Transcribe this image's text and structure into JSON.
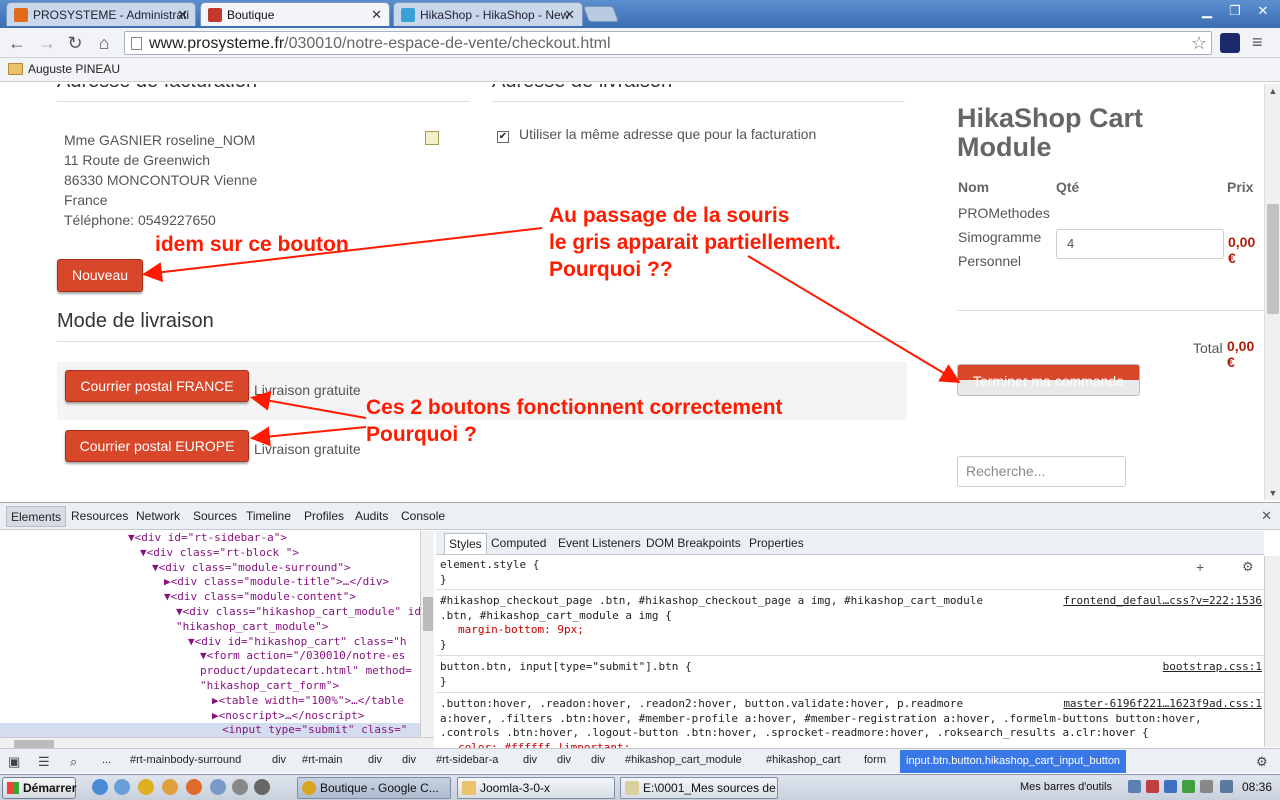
{
  "browser": {
    "tabs": [
      {
        "title": "PROSYSTEME - Administrati",
        "active": false,
        "favicon": "joomla-icon",
        "color": "#e36a1a"
      },
      {
        "title": "Boutique",
        "active": true,
        "favicon": "page-icon",
        "color": "#c0392b"
      },
      {
        "title": "HikaShop - HikaShop - New",
        "active": false,
        "favicon": "hikashop-icon",
        "color": "#3aa0d8"
      }
    ],
    "url_host": "www.prosysteme.fr",
    "url_path": "/030010/notre-espace-de-vente/checkout.html",
    "bookmark": "Auguste PINEAU"
  },
  "page": {
    "billing_title": "Adresse de facturation",
    "shipping_addr_title": "Adresse de livraison",
    "address_lines": [
      "Mme GASNIER roseline_NOM",
      "11 Route de Greenwich",
      "86330 MONCONTOUR Vienne",
      "France",
      "Téléphone: 0549227650"
    ],
    "same_address_label": "Utiliser la même adresse que pour la facturation",
    "same_address_checked": true,
    "new_button": "Nouveau",
    "shipping_mode_title": "Mode de livraison",
    "shipping_options": [
      {
        "button": "Courrier postal FRANCE",
        "label": "Livraison gratuite"
      },
      {
        "button": "Courrier postal EUROPE",
        "label": "Livraison gratuite"
      }
    ],
    "cart": {
      "title": "HikaShop Cart Module",
      "col_name": "Nom",
      "col_qty": "Qté",
      "col_price": "Prix",
      "product_lines": [
        "PROMethodes",
        "Simogramme",
        "Personnel"
      ],
      "qty": "4",
      "price": "0,00 €",
      "total_label": "Total",
      "total_value": "0,00 €",
      "checkout_button": "Terminer ma commande"
    },
    "search_placeholder": "Recherche..."
  },
  "annotations": {
    "a1": "idem sur ce bouton",
    "a2_line1": "Au passage de la souris",
    "a2_line2": "le gris apparait partiellement.",
    "a2_line3": "Pourquoi ??",
    "a3_line1": "Ces 2 boutons fonctionnent correctement",
    "a3_line2": "Pourquoi ?",
    "color": "#ff1a00"
  },
  "devtools": {
    "tabs": [
      "Elements",
      "Resources",
      "Network",
      "Sources",
      "Timeline",
      "Profiles",
      "Audits",
      "Console"
    ],
    "selected_tab": "Elements",
    "dom_lines": [
      "▼<div id=\"rt-sidebar-a\">",
      "▼<div class=\"rt-block \">",
      "▼<div class=\"module-surround\">",
      "▶<div class=\"module-title\">…</div>",
      "▼<div class=\"module-content\">",
      "▼<div class=\"hikashop_cart_module\" id=",
      "\"hikashop_cart_module\">",
      "▼<div id=\"hikashop_cart\" class=\"h",
      "▼<form action=\"/030010/notre-es",
      "product/updatecart.html\" method=",
      "\"hikashop_cart_form\">",
      "▶<table width=\"100%\">…</table",
      "▶<noscript>…</noscript>",
      "<input type=\"submit\" class=\""
    ],
    "style_tabs": [
      "Styles",
      "Computed",
      "Event Listeners",
      "DOM Breakpoints",
      "Properties"
    ],
    "rules": [
      {
        "selector": "element.style {",
        "body": [
          "}"
        ],
        "source": ""
      },
      {
        "selector": "#hikashop_checkout_page .btn, #hikashop_checkout_page a img, #hikashop_cart_module",
        "selector2": ".btn, #hikashop_cart_module a img {",
        "body": [
          "margin-bottom: 9px;",
          "}"
        ],
        "source": "frontend_defaul…css?v=222:1536"
      },
      {
        "selector": "button.btn, input[type=\"submit\"].btn {",
        "body": [
          "}"
        ],
        "source": "bootstrap.css:1"
      },
      {
        "selector": ".button:hover, .readon:hover, .readon2:hover, button.validate:hover, p.readmore",
        "selector2": "a:hover, .filters .btn:hover, #member-profile a:hover, #member-registration a:hover, .formelm-buttons button:hover,",
        "selector3": ".controls .btn:hover, .logout-button .btn:hover, .sprocket-readmore:hover, .roksearch_results a.clr:hover {",
        "body": [
          "color: #ffffff !important;"
        ],
        "source": "master-6196f221…1623f9ad.css:1"
      }
    ],
    "breadcrumbs": [
      "...",
      "#rt-mainbody-surround",
      "div",
      "#rt-main",
      "div",
      "div",
      "#rt-sidebar-a",
      "div",
      "div",
      "div",
      "#hikashop_cart_module",
      "#hikashop_cart",
      "form",
      "input.btn.button.hikashop_cart_input_button"
    ]
  },
  "taskbar": {
    "start": "Démarrer",
    "tasks": [
      {
        "title": "Boutique - Google C...",
        "active": true
      },
      {
        "title": "Joomla-3-0-x",
        "active": false
      },
      {
        "title": "E:\\0001_Mes sources de ...",
        "active": false
      }
    ],
    "toolbar_label": "Mes barres d'outils",
    "clock": "08:36"
  }
}
